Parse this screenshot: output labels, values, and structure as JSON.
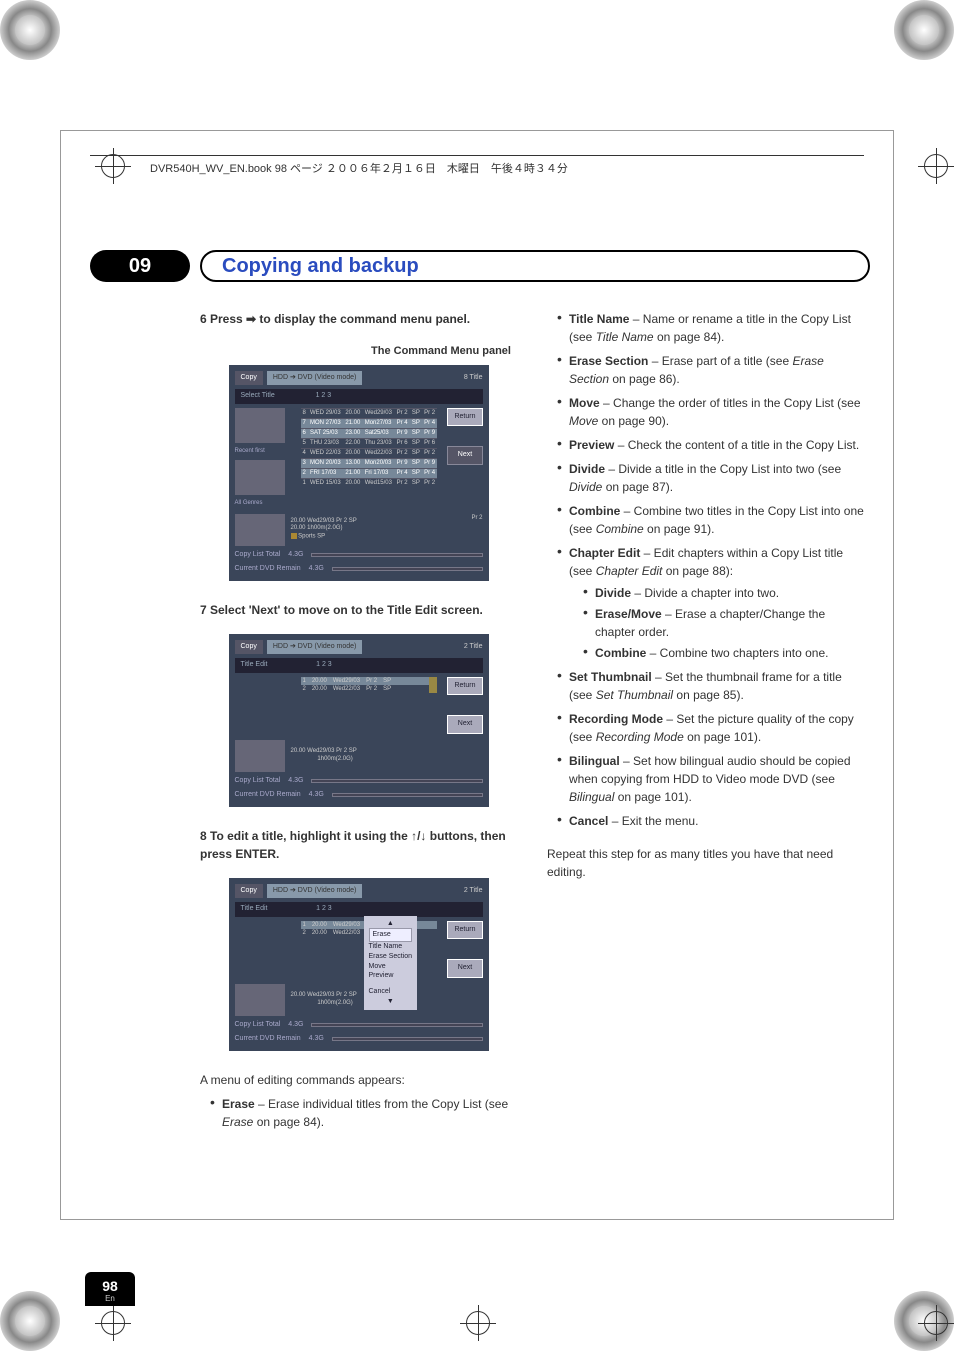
{
  "header_text": "DVR540H_WV_EN.book  98 ページ  ２００６年２月１６日　木曜日　午後４時３４分",
  "chapter": {
    "num": "09",
    "title": "Copying and backup"
  },
  "left": {
    "step6": "6    Press ➡ to display the command menu panel.",
    "panel_label": "The Command Menu panel",
    "step7": "7    Select 'Next' to move on to the Title Edit screen.",
    "step8": "8    To edit a title, highlight it using the ↑/↓ buttons, then press ENTER.",
    "menu_intro": "A menu of editing commands appears:",
    "erase_item": {
      "bold": "Erase",
      "text": " – Erase individual titles from the Copy List (see ",
      "italic": "Erase",
      "tail": " on page 84)."
    }
  },
  "screenshot_common": {
    "copy_label": "Copy",
    "mode_label": "HDD ➔ DVD (Video mode)",
    "return_btn": "Return",
    "next_btn": "Next",
    "copy_list_total": "Copy List Total",
    "current_dvd_remain": "Current DVD Remain",
    "size1": "4.3G",
    "size2": "4.3G"
  },
  "sc1": {
    "titles_count": "8  Title",
    "select_title": "Select Title",
    "recent_first": "Recent first",
    "all_genres": "All Genres",
    "step_indicator": "1  2  3",
    "rows": [
      {
        "n": "8",
        "d": "WED 29/03",
        "t": "20.00",
        "dn": "Wed29/03",
        "pr": "Pr 2",
        "sp": "SP",
        "prx": "Pr 2"
      },
      {
        "n": "7",
        "d": "MON 27/03",
        "t": "21.00",
        "dn": "Mon27/03",
        "pr": "Pr 4",
        "sp": "SP",
        "prx": "Pr 4"
      },
      {
        "n": "6",
        "d": "SAT 25/03",
        "t": "23.00",
        "dn": "Sat25/03",
        "pr": "Pr 9",
        "sp": "SP",
        "prx": "Pr 9"
      },
      {
        "n": "5",
        "d": "THU 23/03",
        "t": "22.00",
        "dn": "Thu 23/03",
        "pr": "Pr 6",
        "sp": "SP",
        "prx": "Pr 6"
      },
      {
        "n": "4",
        "d": "WED 22/03",
        "t": "20.00",
        "dn": "Wed22/03",
        "pr": "Pr 2",
        "sp": "SP",
        "prx": "Pr 2"
      },
      {
        "n": "3",
        "d": "MON 20/03",
        "t": "13.00",
        "dn": "Mon20/03",
        "pr": "Pr 9",
        "sp": "SP",
        "prx": "Pr 9"
      },
      {
        "n": "2",
        "d": "FRI 17/03",
        "t": "21.00",
        "dn": "Fri 17/03",
        "pr": "Pr 4",
        "sp": "SP",
        "prx": "Pr 4"
      },
      {
        "n": "1",
        "d": "WED 15/03",
        "t": "20.00",
        "dn": "Wed15/03",
        "pr": "Pr 2",
        "sp": "SP",
        "prx": "Pr 2"
      }
    ],
    "footer": {
      "l1": "20.00   Wed29/03   Pr 2   SP",
      "l2": "20.00           1h00m(2.0G)",
      "l3": "Sports        SP",
      "prx": "Pr 2"
    }
  },
  "sc2": {
    "titles_count": "2  Title",
    "title_edit": "Title Edit",
    "step_indicator": "1  2  3",
    "rows": [
      {
        "n": "1",
        "t": "20.00",
        "dn": "Wed29/03",
        "pr": "Pr 2",
        "sp": "SP"
      },
      {
        "n": "2",
        "t": "20.00",
        "dn": "Wed22/03",
        "pr": "Pr 2",
        "sp": "SP"
      }
    ],
    "footer": {
      "l1": "20.00   Wed29/03   Pr 2   SP",
      "dur": "1h00m(2.0G)"
    }
  },
  "sc3": {
    "titles_count": "2  Title",
    "title_edit": "Title Edit",
    "step_indicator": "1  2  3",
    "rows": [
      {
        "n": "1",
        "t": "20.00",
        "dn": "Wed29/03",
        "pr": "Pr 2"
      },
      {
        "n": "2",
        "t": "20.00",
        "dn": "Wed22/03",
        "pr": "Pr 2"
      }
    ],
    "context": {
      "items": [
        "Erase",
        "Title Name",
        "Erase Section",
        "Move",
        "Preview",
        "",
        "Cancel"
      ]
    },
    "footer": {
      "l1": "20.00   Wed29/03   Pr 2   SP",
      "dur": "1h00m(2.0G)"
    }
  },
  "right": {
    "items": [
      {
        "bold": "Title Name",
        "text": " – Name or rename a title in the Copy List (see ",
        "italic": "Title Name",
        "tail": " on page 84)."
      },
      {
        "bold": "Erase Section",
        "text": " – Erase part of a title (see ",
        "italic": "Erase Section",
        "tail": " on page 86)."
      },
      {
        "bold": "Move",
        "text": " – Change the order of titles in the Copy List (see ",
        "italic": "Move",
        "tail": " on page 90)."
      },
      {
        "bold": "Preview",
        "text": " – Check the content of a title in the Copy List.",
        "italic": "",
        "tail": ""
      },
      {
        "bold": "Divide",
        "text": " – Divide a title in the Copy List into two (see ",
        "italic": "Divide",
        "tail": " on page 87)."
      },
      {
        "bold": "Combine",
        "text": " – Combine two titles in the Copy List into one (see ",
        "italic": "Combine",
        "tail": " on page 91)."
      },
      {
        "bold": "Chapter Edit",
        "text": " – Edit chapters within a Copy List title (see ",
        "italic": "Chapter Edit",
        "tail": " on page 88):"
      },
      {
        "bold": "Set Thumbnail",
        "text": " – Set the thumbnail frame for a title (see ",
        "italic": "Set Thumbnail",
        "tail": " on page 85)."
      },
      {
        "bold": "Recording Mode",
        "text": " – Set the picture quality of the copy (see ",
        "italic": "Recording Mode",
        "tail": " on page 101)."
      },
      {
        "bold": "Bilingual",
        "text": " – Set how bilingual audio should be copied when copying from HDD to Video mode DVD (see ",
        "italic": "Bilingual",
        "tail": " on page 101)."
      },
      {
        "bold": "Cancel",
        "text": " – Exit the menu.",
        "italic": "",
        "tail": ""
      }
    ],
    "sub_chapter": [
      {
        "bold": "Divide",
        "text": " – Divide a chapter into two."
      },
      {
        "bold": "Erase/Move",
        "text": " – Erase a chapter/Change the chapter order."
      },
      {
        "bold": "Combine",
        "text": " – Combine two chapters into one."
      }
    ],
    "closing": "Repeat this step for as many titles you have that need editing."
  },
  "page_num": "98",
  "page_lang": "En"
}
